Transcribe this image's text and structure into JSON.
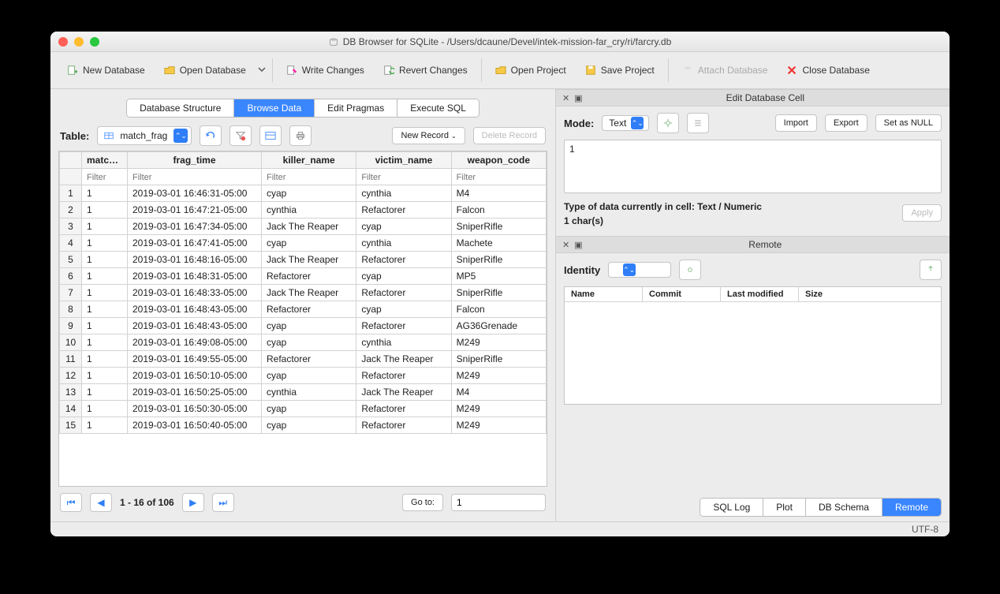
{
  "window": {
    "title": "DB Browser for SQLite - /Users/dcaune/Devel/intek-mission-far_cry/ri/farcry.db"
  },
  "toolbar": {
    "new_db": "New Database",
    "open_db": "Open Database",
    "write": "Write Changes",
    "revert": "Revert Changes",
    "open_proj": "Open Project",
    "save_proj": "Save Project",
    "attach": "Attach Database",
    "close_db": "Close Database"
  },
  "tabs": {
    "a": "Database Structure",
    "b": "Browse Data",
    "c": "Edit Pragmas",
    "d": "Execute SQL"
  },
  "browse": {
    "table_label": "Table:",
    "table_name": "match_frag",
    "new_record": "New Record",
    "delete_record": "Delete Record",
    "columns": [
      "match_id",
      "frag_time",
      "killer_name",
      "victim_name",
      "weapon_code"
    ],
    "filter_placeholder": "Filter",
    "rows": [
      [
        "1",
        "2019-03-01 16:46:31-05:00",
        "cyap",
        "cynthia",
        "M4"
      ],
      [
        "1",
        "2019-03-01 16:47:21-05:00",
        "cynthia",
        "Refactorer",
        "Falcon"
      ],
      [
        "1",
        "2019-03-01 16:47:34-05:00",
        "Jack The Reaper",
        "cyap",
        "SniperRifle"
      ],
      [
        "1",
        "2019-03-01 16:47:41-05:00",
        "cyap",
        "cynthia",
        "Machete"
      ],
      [
        "1",
        "2019-03-01 16:48:16-05:00",
        "Jack The Reaper",
        "Refactorer",
        "SniperRifle"
      ],
      [
        "1",
        "2019-03-01 16:48:31-05:00",
        "Refactorer",
        "cyap",
        "MP5"
      ],
      [
        "1",
        "2019-03-01 16:48:33-05:00",
        "Jack The Reaper",
        "Refactorer",
        "SniperRifle"
      ],
      [
        "1",
        "2019-03-01 16:48:43-05:00",
        "Refactorer",
        "cyap",
        "Falcon"
      ],
      [
        "1",
        "2019-03-01 16:48:43-05:00",
        "cyap",
        "Refactorer",
        "AG36Grenade"
      ],
      [
        "1",
        "2019-03-01 16:49:08-05:00",
        "cyap",
        "cynthia",
        "M249"
      ],
      [
        "1",
        "2019-03-01 16:49:55-05:00",
        "Refactorer",
        "Jack The Reaper",
        "SniperRifle"
      ],
      [
        "1",
        "2019-03-01 16:50:10-05:00",
        "cyap",
        "Refactorer",
        "M249"
      ],
      [
        "1",
        "2019-03-01 16:50:25-05:00",
        "cynthia",
        "Jack The Reaper",
        "M4"
      ],
      [
        "1",
        "2019-03-01 16:50:30-05:00",
        "cyap",
        "Refactorer",
        "M249"
      ],
      [
        "1",
        "2019-03-01 16:50:40-05:00",
        "cyap",
        "Refactorer",
        "M249"
      ]
    ],
    "pager_label": "1 - 16 of 106",
    "goto_label": "Go to:",
    "goto_value": "1"
  },
  "editcell": {
    "title": "Edit Database Cell",
    "mode_label": "Mode:",
    "mode_value": "Text",
    "import": "Import",
    "export": "Export",
    "set_null": "Set as NULL",
    "value": "1",
    "type_info": "Type of data currently in cell: Text / Numeric",
    "chars": "1 char(s)",
    "apply": "Apply"
  },
  "remote": {
    "title": "Remote",
    "identity_label": "Identity",
    "cols": {
      "name": "Name",
      "commit": "Commit",
      "modified": "Last modified",
      "size": "Size"
    },
    "tabs": {
      "sql": "SQL Log",
      "plot": "Plot",
      "schema": "DB Schema",
      "remote": "Remote"
    }
  },
  "footer": {
    "enc": "UTF-8"
  }
}
